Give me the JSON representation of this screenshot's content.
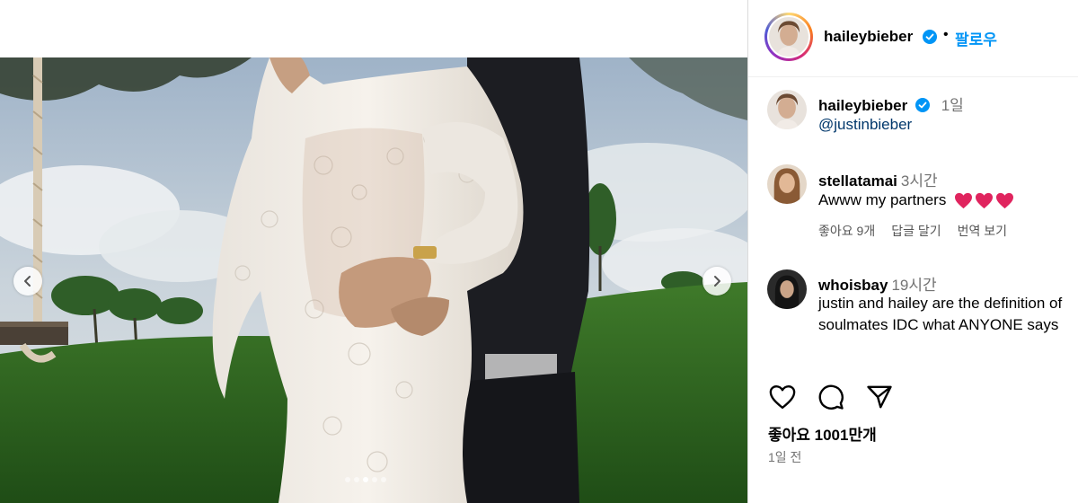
{
  "post": {
    "author": "haileybieber",
    "follow_label": "팔로우",
    "separator": "•",
    "caption": {
      "username": "haileybieber",
      "time": "1일",
      "text": "@justinbieber"
    },
    "comments": [
      {
        "username": "stellatamai",
        "time": "3시간",
        "text": "Awww my partners",
        "emoji": "red-heart x3",
        "actions": {
          "likes": "좋아요 9개",
          "reply": "답글 달기",
          "translate": "번역 보기"
        }
      },
      {
        "username": "whoisbay",
        "time": "19시간",
        "text": "justin and hailey are the definition of soulmates IDC what ANYONE says"
      }
    ],
    "likes_label": "좋아요 1001만개",
    "posted_ago": "1일 전",
    "carousel": {
      "dot_count": 5,
      "active_index": 2
    }
  },
  "icons": {
    "prev": "chevron-left-icon",
    "next": "chevron-right-icon",
    "like": "heart-outline-icon",
    "comment": "comment-bubble-icon",
    "share": "paper-plane-icon",
    "verified": "verified-badge-icon"
  },
  "colors": {
    "accent_blue": "#0095f6",
    "verified_blue": "#0095f6",
    "mention": "#00376b",
    "muted": "#737373",
    "heart_red": "#e0245e"
  }
}
